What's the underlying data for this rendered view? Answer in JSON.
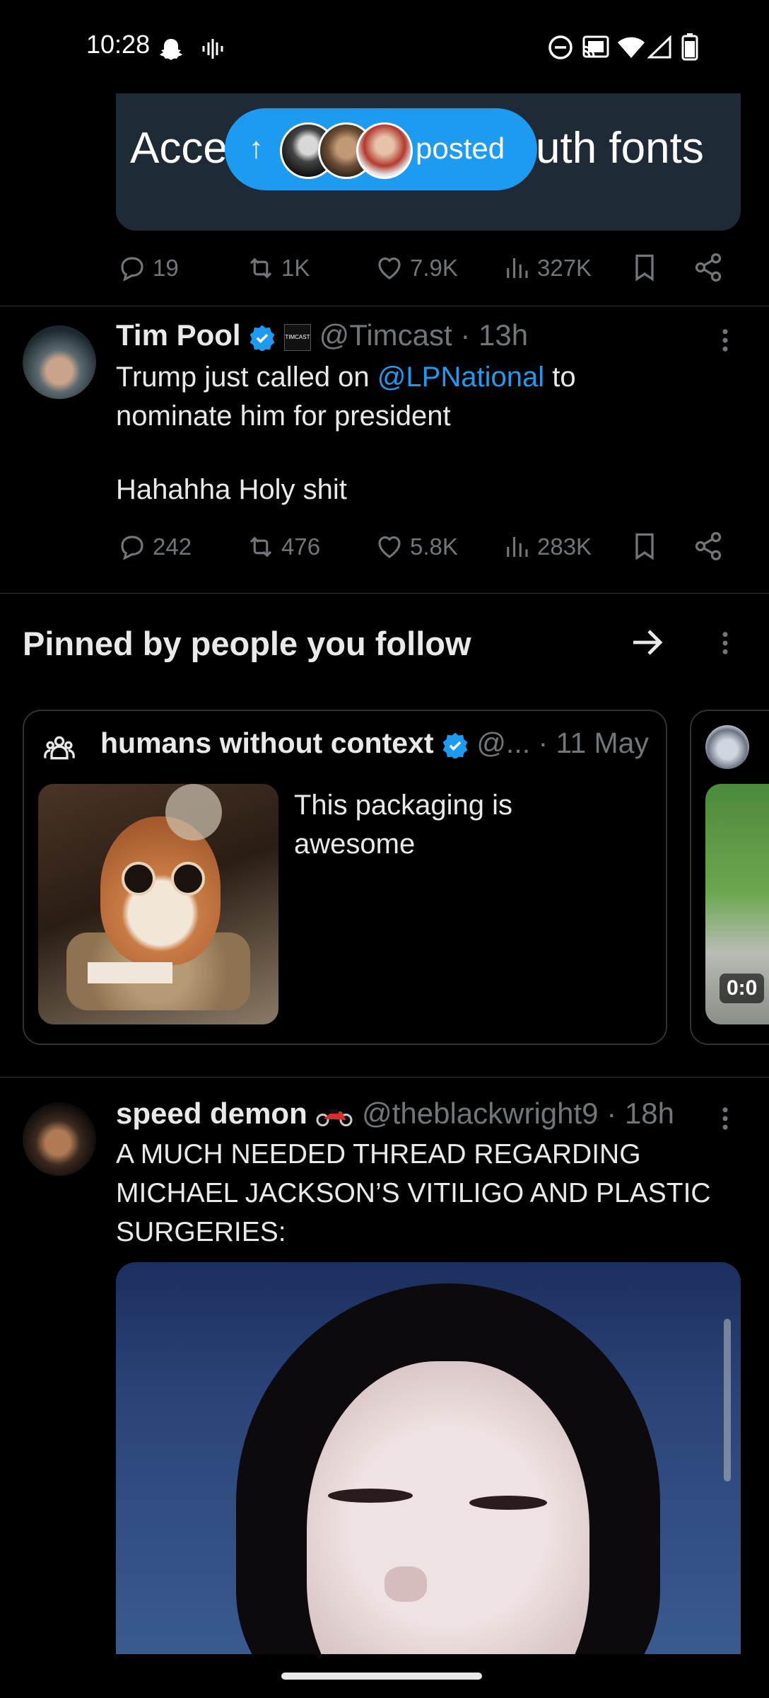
{
  "status_bar": {
    "time": "10:28",
    "icons": [
      "snapchat-icon",
      "voicemail-icon",
      "do-not-disturb-icon",
      "cast-icon",
      "wifi-icon",
      "signal-icon",
      "battery-icon"
    ]
  },
  "quoted_card": {
    "text_left": "Acce",
    "text_right": "uth fonts"
  },
  "new_posts_pill": {
    "label": "posted",
    "arrow": "↑"
  },
  "tweet1_actions": {
    "replies": "19",
    "retweets": "1K",
    "likes": "7.9K",
    "views": "327K"
  },
  "tweet2": {
    "name": "Tim Pool",
    "handle": "@Timcast",
    "time": "· 13h",
    "text_before": "Trump just called on ",
    "mention": "@LPNational",
    "text_after": " to nominate him for president",
    "text_line2": "Hahahha Holy shit",
    "replies": "242",
    "retweets": "476",
    "likes": "5.8K",
    "views": "283K"
  },
  "pinned": {
    "heading": "Pinned by people you follow",
    "card": {
      "name": "humans without context",
      "handle": "@...",
      "time": "· 11 May",
      "text": "This packaging is awesome"
    },
    "next_card_video_time": "0:0"
  },
  "tweet3": {
    "name": "speed demon",
    "handle": "@theblackwright9",
    "time": "· 18h",
    "text": "A MUCH NEEDED THREAD REGARDING MICHAEL JACKSON’S VITILIGO AND PLASTIC SURGERIES:"
  },
  "colors": {
    "accent": "#1d9bf0",
    "background": "#000000",
    "muted": "#71767b",
    "divider": "#2f3336"
  }
}
